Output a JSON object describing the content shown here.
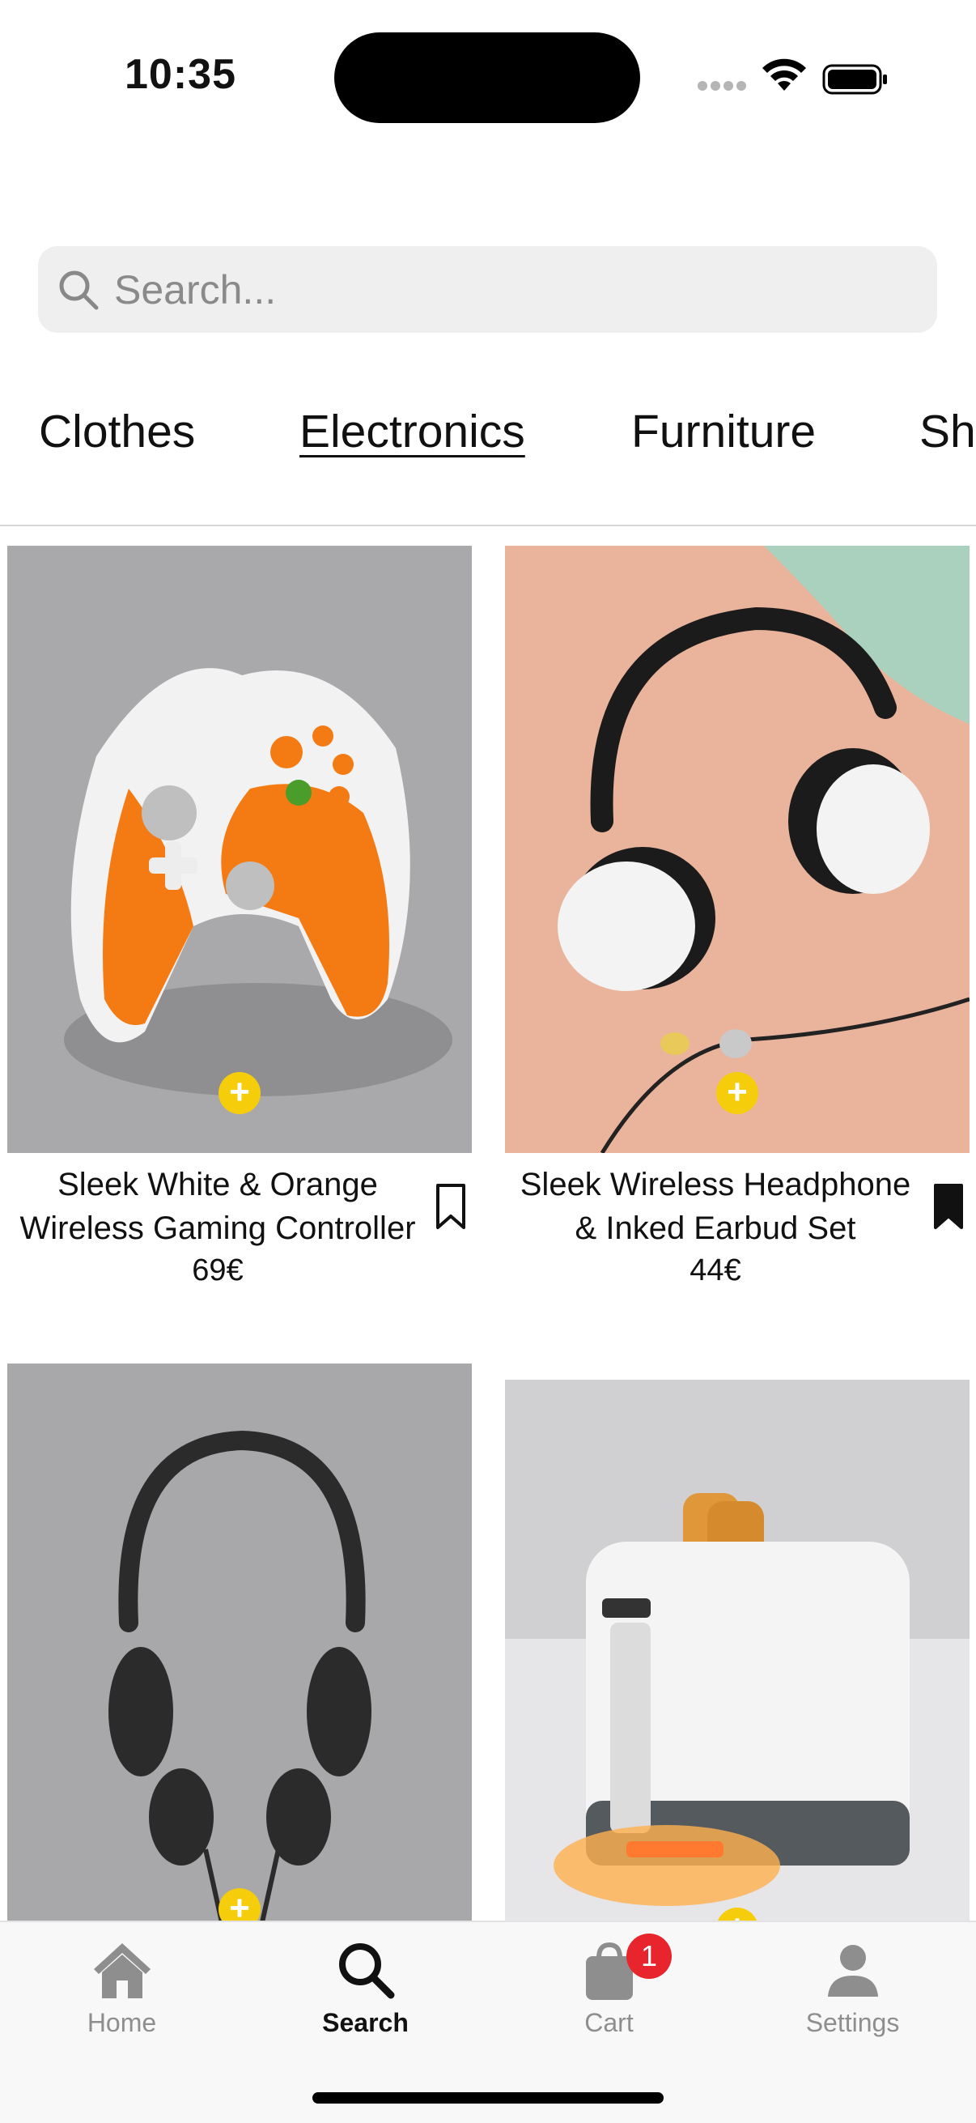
{
  "status_bar": {
    "time": "10:35"
  },
  "search": {
    "placeholder": "Search...",
    "icon": "search-icon"
  },
  "categories": [
    {
      "label": "Clothes",
      "active": false
    },
    {
      "label": "Electronics",
      "active": true
    },
    {
      "label": "Furniture",
      "active": false
    },
    {
      "label": "Sh",
      "active": false
    }
  ],
  "products": [
    {
      "name_line1": "Sleek White & Orange",
      "name_line2": "Wireless Gaming Controller",
      "price": "69€",
      "bookmarked": false,
      "add_symbol": "+"
    },
    {
      "name_line1": "Sleek Wireless Headphone",
      "name_line2": "& Inked Earbud Set",
      "price": "44€",
      "bookmarked": true,
      "add_symbol": "+"
    },
    {
      "add_symbol": "+"
    },
    {
      "add_symbol": "+"
    }
  ],
  "tab_bar": {
    "tabs": [
      {
        "label": "Home",
        "icon": "house-icon",
        "active": false
      },
      {
        "label": "Search",
        "icon": "search-icon",
        "active": true
      },
      {
        "label": "Cart",
        "icon": "bag-icon",
        "active": false,
        "badge": "1"
      },
      {
        "label": "Settings",
        "icon": "person-icon",
        "active": false
      }
    ]
  },
  "colors": {
    "accent": "#f6cd0b",
    "badge": "#e8242c",
    "inactive_tab": "#8e8e8e"
  }
}
